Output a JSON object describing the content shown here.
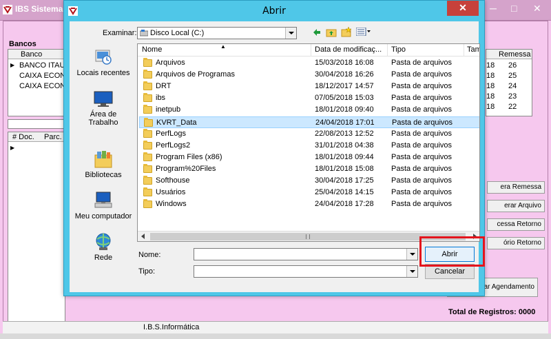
{
  "background_window": {
    "title": "IBS Sistemas",
    "bancos_label": "Bancos",
    "bancos_column": "Banco",
    "bancos": [
      "BANCO ITAU",
      "CAIXA ECONO",
      "CAIXA ECONO"
    ],
    "remessa_column": "Remessa",
    "remessa_rows": [
      {
        "a": "18",
        "b": "26"
      },
      {
        "a": "18",
        "b": "25"
      },
      {
        "a": "18",
        "b": "24"
      },
      {
        "a": "18",
        "b": "23"
      },
      {
        "a": "18",
        "b": "22"
      }
    ],
    "docs_columns": [
      "# Doc.",
      "Parc."
    ],
    "side_buttons": [
      "era Remessa",
      "erar Arquivo",
      "cessa Retorno",
      "ório Retorno",
      "ar Agendamento"
    ],
    "total_label": "Total de Registros: 0000",
    "status_text": "I.B.S.Informática"
  },
  "dialog": {
    "title": "Abrir",
    "close_glyph": "✕",
    "look_in_label": "Examinar:",
    "look_in_value": "Disco Local (C:)",
    "places": [
      {
        "label": "Locais recentes",
        "icon": "recent-places-icon"
      },
      {
        "label": "Área de Trabalho",
        "icon": "desktop-icon"
      },
      {
        "label": "Bibliotecas",
        "icon": "libraries-icon"
      },
      {
        "label": "Meu computador",
        "icon": "computer-icon"
      },
      {
        "label": "Rede",
        "icon": "network-icon"
      }
    ],
    "columns": {
      "name": "Nome",
      "date": "Data de modificaç...",
      "type": "Tipo",
      "size": "Tam"
    },
    "files": [
      {
        "name": "Arquivos",
        "date": "15/03/2018 16:08",
        "type": "Pasta de arquivos",
        "selected": false
      },
      {
        "name": "Arquivos de Programas",
        "date": "30/04/2018 16:26",
        "type": "Pasta de arquivos",
        "selected": false
      },
      {
        "name": "DRT",
        "date": "18/12/2017 14:57",
        "type": "Pasta de arquivos",
        "selected": false
      },
      {
        "name": "ibs",
        "date": "07/05/2018 15:03",
        "type": "Pasta de arquivos",
        "selected": false
      },
      {
        "name": "inetpub",
        "date": "18/01/2018 09:40",
        "type": "Pasta de arquivos",
        "selected": false
      },
      {
        "name": "KVRT_Data",
        "date": "24/04/2018 17:01",
        "type": "Pasta de arquivos",
        "selected": true
      },
      {
        "name": "PerfLogs",
        "date": "22/08/2013 12:52",
        "type": "Pasta de arquivos",
        "selected": false
      },
      {
        "name": "PerfLogs2",
        "date": "31/01/2018 04:38",
        "type": "Pasta de arquivos",
        "selected": false
      },
      {
        "name": "Program Files (x86)",
        "date": "18/01/2018 09:44",
        "type": "Pasta de arquivos",
        "selected": false
      },
      {
        "name": "Program%20Files",
        "date": "18/01/2018 15:08",
        "type": "Pasta de arquivos",
        "selected": false
      },
      {
        "name": "Softhouse",
        "date": "30/04/2018 17:25",
        "type": "Pasta de arquivos",
        "selected": false
      },
      {
        "name": "Usuários",
        "date": "25/04/2018 14:15",
        "type": "Pasta de arquivos",
        "selected": false
      },
      {
        "name": "Windows",
        "date": "24/04/2018 17:28",
        "type": "Pasta de arquivos",
        "selected": false
      }
    ],
    "name_label": "Nome:",
    "name_value": "",
    "type_label": "Tipo:",
    "type_value": "",
    "open_button": "Abrir",
    "cancel_button": "Cancelar",
    "highlight_color": "#e4141c"
  }
}
